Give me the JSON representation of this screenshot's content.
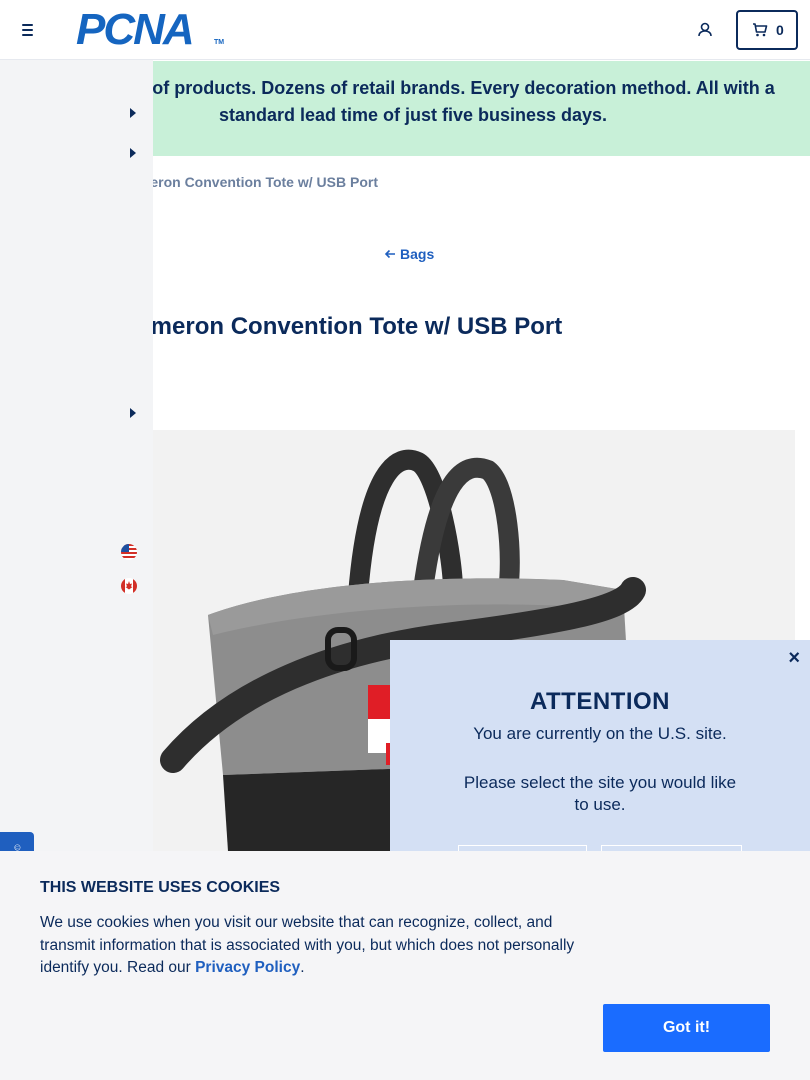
{
  "header": {
    "logo_text": "PCNA",
    "logo_tm": "TM",
    "cart_count": "0"
  },
  "banner": {
    "text": "Thousands of products. Dozens of retail brands. Every decoration method. All with a standard lead time of just five business days."
  },
  "breadcrumb": {
    "current": "Cameron Convention Tote w/ USB Port"
  },
  "back_link": {
    "label": "Bags"
  },
  "product": {
    "title": "Cameron Convention Tote w/ USB Port",
    "brand_logo_colors": [
      "#e01e26",
      "#ffffff",
      "#2b2b2b"
    ],
    "bag_colors": {
      "heather": "#8d8d8d",
      "body": "#262626",
      "strap": "#2e2e2e"
    }
  },
  "sidenav": {
    "flags": [
      "us-flag-icon",
      "canada-flag-icon"
    ]
  },
  "attention_modal": {
    "close": "×",
    "title": "ATTENTION",
    "message": "You are currently on the U.S. site.",
    "prompt": "Please select the site you would like to use."
  },
  "cookie_banner": {
    "title": "THIS WEBSITE USES COOKIES",
    "text_before": "We use cookies when you visit our website that can recognize, collect, and transmit information that is associated with you, but which does not personally identify you. Read our ",
    "link": "Privacy Policy",
    "text_after": ".",
    "button": "Got it!"
  },
  "colors": {
    "navy": "#0b2a5b",
    "accent_blue": "#1a6cff",
    "banner_green": "#c8f0d8",
    "modal_blue": "#d4e0f4"
  }
}
